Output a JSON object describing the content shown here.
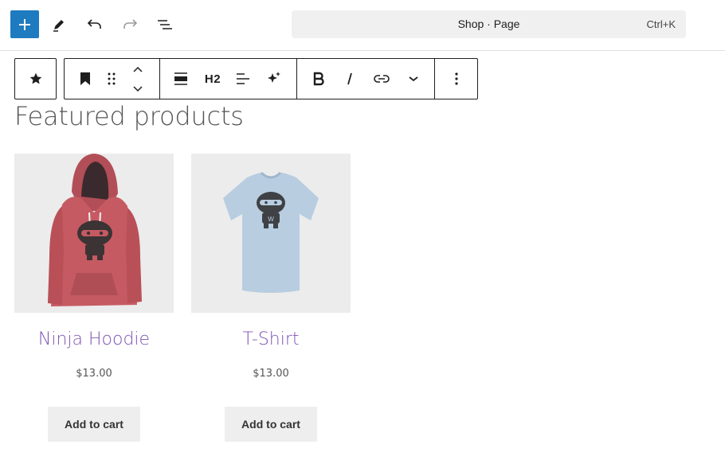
{
  "header": {
    "document_title": "Shop · Page",
    "shortcut": "Ctrl+K",
    "icons": [
      "plus-icon",
      "pencil-icon",
      "undo-icon",
      "redo-icon",
      "list-view-icon"
    ]
  },
  "block_toolbar": {
    "heading_level": "H2",
    "icons": [
      "star-icon",
      "bookmark-icon",
      "drag-handle-icon",
      "move-up-icon",
      "move-down-icon",
      "align-icon",
      "text-align-icon",
      "sparkle-icon",
      "bold-icon",
      "italic-icon",
      "link-icon",
      "chevron-down-icon",
      "more-options-icon"
    ]
  },
  "content": {
    "heading": "Featured products",
    "products": [
      {
        "name": "Ninja Hoodie",
        "price": "$13.00",
        "button": "Add to cart",
        "image": "hoodie-image"
      },
      {
        "name": "T-Shirt",
        "price": "$13.00",
        "button": "Add to cart",
        "image": "tshirt-image"
      }
    ]
  },
  "colors": {
    "accent": "#1e7bc0",
    "product_link": "#7f54b3",
    "hoodie": "#c65a62",
    "tshirt": "#b8cde0"
  }
}
